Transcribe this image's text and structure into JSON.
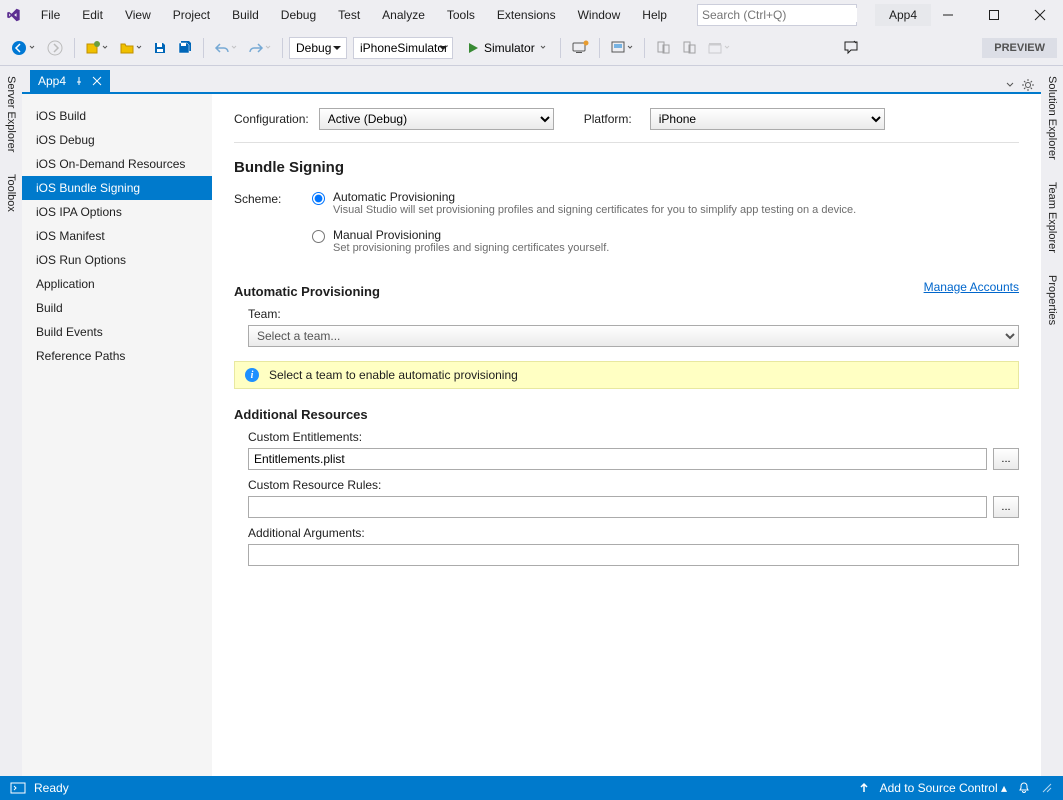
{
  "title_app": "App4",
  "menu": [
    "File",
    "Edit",
    "View",
    "Project",
    "Build",
    "Debug",
    "Test",
    "Analyze",
    "Tools",
    "Extensions",
    "Window",
    "Help"
  ],
  "search_placeholder": "Search (Ctrl+Q)",
  "toolbar": {
    "config": "Debug",
    "target": "iPhoneSimulator",
    "run_label": "Simulator",
    "preview": "PREVIEW"
  },
  "side_left": [
    "Server Explorer",
    "Toolbox"
  ],
  "side_right": [
    "Solution Explorer",
    "Team Explorer",
    "Properties"
  ],
  "doc_tab": "App4",
  "settings_nav": [
    "iOS Build",
    "iOS Debug",
    "iOS On-Demand Resources",
    "iOS Bundle Signing",
    "iOS IPA Options",
    "iOS Manifest",
    "iOS Run Options",
    "Application",
    "Build",
    "Build Events",
    "Reference Paths"
  ],
  "settings_nav_active": 3,
  "config_row": {
    "config_label": "Configuration:",
    "config_value": "Active (Debug)",
    "platform_label": "Platform:",
    "platform_value": "iPhone"
  },
  "bundle_signing": {
    "title": "Bundle Signing",
    "scheme_label": "Scheme:",
    "auto_title": "Automatic Provisioning",
    "auto_desc": "Visual Studio will set provisioning profiles and signing certificates for you to simplify app testing on a device.",
    "manual_title": "Manual Provisioning",
    "manual_desc": "Set provisioning profiles and signing certificates yourself."
  },
  "auto_prov": {
    "title": "Automatic Provisioning",
    "manage": "Manage Accounts",
    "team_label": "Team:",
    "team_value": "Select a team...",
    "banner": "Select a team to enable automatic provisioning"
  },
  "additional": {
    "title": "Additional Resources",
    "entitlements_label": "Custom Entitlements:",
    "entitlements_value": "Entitlements.plist",
    "rules_label": "Custom Resource Rules:",
    "rules_value": "",
    "args_label": "Additional Arguments:",
    "args_value": "",
    "browse": "..."
  },
  "status": {
    "ready": "Ready",
    "source_control": "Add to Source Control"
  }
}
